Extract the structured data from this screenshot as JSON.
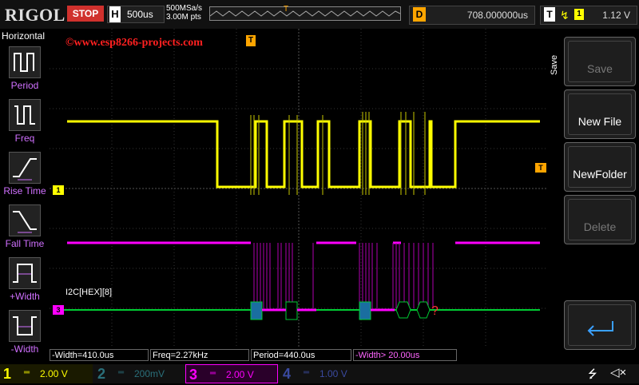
{
  "topbar": {
    "logo": "RIGOL",
    "run_state": "STOP",
    "timebase_letter": "H",
    "timebase": "500us",
    "sample_rate": "500MSa/s",
    "memory_depth": "3.00M pts",
    "delay_letter": "D",
    "delay_value": "708.000000us",
    "trigger_letter": "T",
    "trigger_channel": "1",
    "trigger_level": "1.12 V"
  },
  "left_menu": {
    "title": "Horizontal",
    "items": [
      {
        "label": "Period",
        "icon": "period-icon"
      },
      {
        "label": "Freq",
        "icon": "freq-icon"
      },
      {
        "label": "Rise Time",
        "icon": "rise-time-icon"
      },
      {
        "label": "Fall Time",
        "icon": "fall-time-icon"
      },
      {
        "label": "+Width",
        "icon": "pos-width-icon"
      },
      {
        "label": "-Width",
        "icon": "neg-width-icon"
      }
    ]
  },
  "screen": {
    "watermark": "©www.esp8266-projects.com",
    "decode_label": "I2C[HEX][8]",
    "ch1_marker": "1",
    "ch3_marker": "3",
    "trigger_marker": "T"
  },
  "right_menu": {
    "side_label": "Save",
    "buttons": [
      {
        "label": "Save",
        "enabled": false
      },
      {
        "label": "New File",
        "enabled": true
      },
      {
        "label": "NewFolder",
        "enabled": true
      },
      {
        "label": "Delete",
        "enabled": false
      },
      {
        "label": "",
        "enabled": true,
        "icon": "return-icon"
      }
    ]
  },
  "measurements": [
    "-Width=410.0us",
    "Freq=2.27kHz",
    "Period=440.0us",
    "-Width> 20.00us"
  ],
  "channels": [
    {
      "num": "1",
      "scale": "2.00 V",
      "color": "#ffff00",
      "active": true
    },
    {
      "num": "2",
      "scale": "200mV",
      "color": "#2a6f7a",
      "active": false
    },
    {
      "num": "3",
      "scale": "2.00 V",
      "color": "#ff00ff",
      "active": true
    },
    {
      "num": "4",
      "scale": "1.00 V",
      "color": "#3a4aa0",
      "active": false
    }
  ],
  "colors": {
    "ch1": "#ffff00",
    "ch3": "#ff00ff",
    "decode_bus": "#00cc33",
    "decode_frame": "#1a6ea0",
    "trigger": "#ffa500",
    "stop": "#d0312d"
  }
}
